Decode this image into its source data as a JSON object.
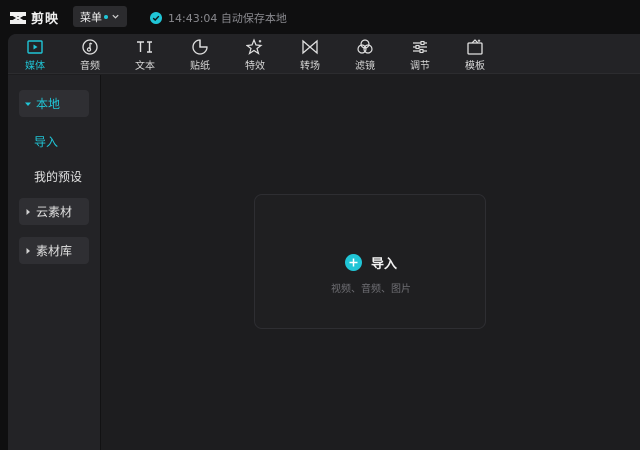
{
  "app": {
    "name": "剪映"
  },
  "titlebar": {
    "menu_label": "菜单",
    "save_status": "14:43:04 自动保存本地"
  },
  "tabs": [
    {
      "label": "媒体",
      "icon": "media-icon",
      "active": true
    },
    {
      "label": "音频",
      "icon": "audio-icon"
    },
    {
      "label": "文本",
      "icon": "text-icon"
    },
    {
      "label": "贴纸",
      "icon": "sticker-icon"
    },
    {
      "label": "特效",
      "icon": "effects-icon"
    },
    {
      "label": "转场",
      "icon": "transition-icon"
    },
    {
      "label": "滤镜",
      "icon": "filter-icon"
    },
    {
      "label": "调节",
      "icon": "adjust-icon"
    },
    {
      "label": "模板",
      "icon": "template-icon"
    }
  ],
  "sidebar": {
    "local": "本地",
    "import": "导入",
    "my_presets": "我的预设",
    "cloud": "云素材",
    "library": "素材库"
  },
  "import_panel": {
    "label": "导入",
    "hint": "视频、音频、图片"
  },
  "colors": {
    "accent": "#20c5d6",
    "background": "#0f0f10",
    "panel": "#1d1d1f"
  }
}
